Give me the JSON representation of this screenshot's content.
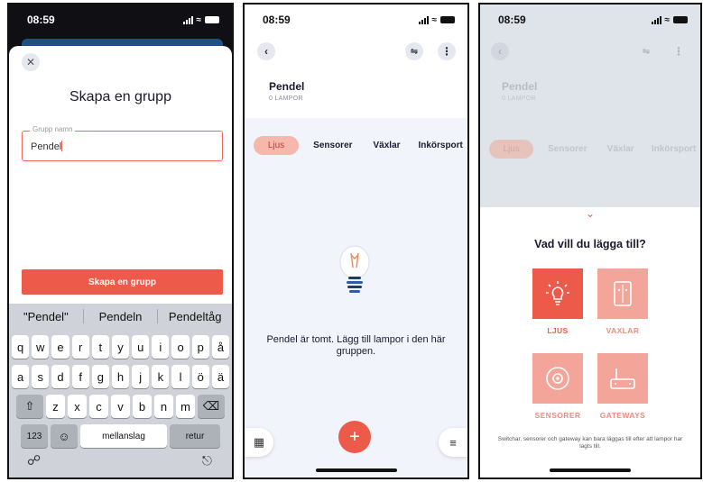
{
  "colors": {
    "accent": "#ee5a4a",
    "accent_light": "#f6b7ad",
    "tile_light": "#f4a59a",
    "bg_light": "#f1f4fa"
  },
  "statusbar": {
    "time": "08:59"
  },
  "create_group": {
    "title": "Skapa en grupp",
    "field_label": "Grupp namn",
    "field_value": "Pendel",
    "submit": "Skapa en grupp",
    "close_icon": "close-icon"
  },
  "keyboard": {
    "suggestions": [
      "\"Pendel\"",
      "Pendeln",
      "Pendeltåg"
    ],
    "row1": [
      "q",
      "w",
      "e",
      "r",
      "t",
      "y",
      "u",
      "i",
      "o",
      "p",
      "å"
    ],
    "row2": [
      "a",
      "s",
      "d",
      "f",
      "g",
      "h",
      "j",
      "k",
      "l",
      "ö",
      "ä"
    ],
    "row3": [
      "z",
      "x",
      "c",
      "v",
      "b",
      "n",
      "m"
    ],
    "num_key": "123",
    "space_key": "mellanslag",
    "return_key": "retur",
    "shift_icon": "shift-icon",
    "backspace_icon": "backspace-icon",
    "emoji_icon": "emoji-icon",
    "globe_icon": "globe-icon",
    "mic_icon": "mic-icon"
  },
  "group": {
    "name": "Pendel",
    "subtitle": "0 LAMPOR",
    "tabs": [
      "Ljus",
      "Sensorer",
      "Växlar",
      "Inkörsport"
    ],
    "empty_message": "Pendel är tomt. Lägg till lampor i den här gruppen."
  },
  "add_sheet": {
    "title": "Vad vill du lägga till?",
    "options": [
      {
        "label": "LJUS",
        "icon": "bulb-icon"
      },
      {
        "label": "VAXLAR",
        "icon": "switch-icon"
      },
      {
        "label": "SENSORER",
        "icon": "sensor-icon"
      },
      {
        "label": "GATEWAYS",
        "icon": "gateway-icon"
      }
    ],
    "note": "Switchar, sensorer och gateway kan bara läggas till efter att lampor har lagts till."
  }
}
